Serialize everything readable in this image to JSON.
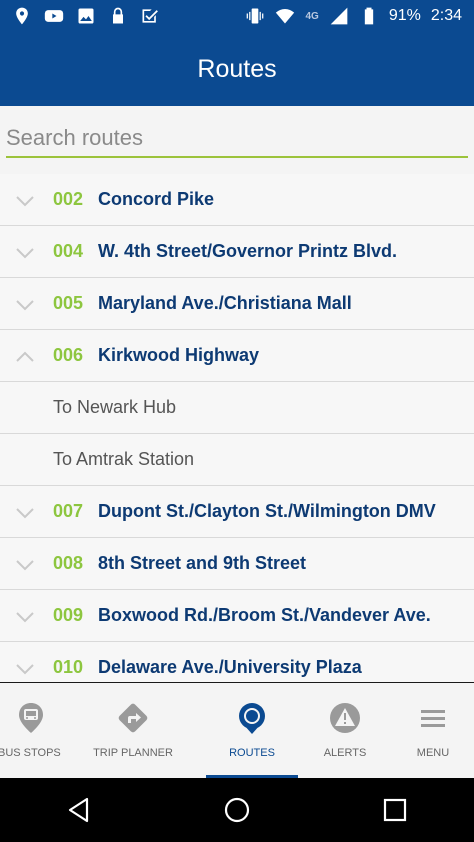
{
  "status_bar": {
    "icons_left": [
      "location-icon",
      "youtube-icon",
      "image-icon",
      "lock-icon",
      "checkbox-icon"
    ],
    "network": "4G",
    "battery": "91%",
    "time": "2:34"
  },
  "header": {
    "title": "Routes"
  },
  "search": {
    "placeholder": "Search routes",
    "value": ""
  },
  "routes": [
    {
      "number": "002",
      "name": "Concord Pike",
      "expanded": false
    },
    {
      "number": "004",
      "name": "W. 4th Street/Governor Printz Blvd.",
      "expanded": false
    },
    {
      "number": "005",
      "name": "Maryland Ave./Christiana Mall",
      "expanded": false
    },
    {
      "number": "006",
      "name": "Kirkwood Highway",
      "expanded": true,
      "directions": [
        "To Newark Hub",
        "To Amtrak Station"
      ]
    },
    {
      "number": "007",
      "name": "Dupont St./Clayton St./Wilmington DMV",
      "expanded": false
    },
    {
      "number": "008",
      "name": "8th Street and 9th Street",
      "expanded": false
    },
    {
      "number": "009",
      "name": "Boxwood Rd./Broom St./Vandever Ave.",
      "expanded": false
    },
    {
      "number": "010",
      "name": "Delaware Ave./University Plaza",
      "expanded": false
    }
  ],
  "tabs": [
    {
      "label": "BUS STOPS",
      "icon": "bus-stop-icon",
      "active": false
    },
    {
      "label": "TRIP PLANNER",
      "icon": "trip-planner-icon",
      "active": false
    },
    {
      "label": "ROUTES",
      "icon": "routes-pin-icon",
      "active": true
    },
    {
      "label": "ALERTS",
      "icon": "alert-icon",
      "active": false
    },
    {
      "label": "MENU",
      "icon": "menu-icon",
      "active": false
    }
  ],
  "colors": {
    "primary": "#0b4a91",
    "accent": "#8dc63f",
    "route_name": "#0d3a73"
  }
}
